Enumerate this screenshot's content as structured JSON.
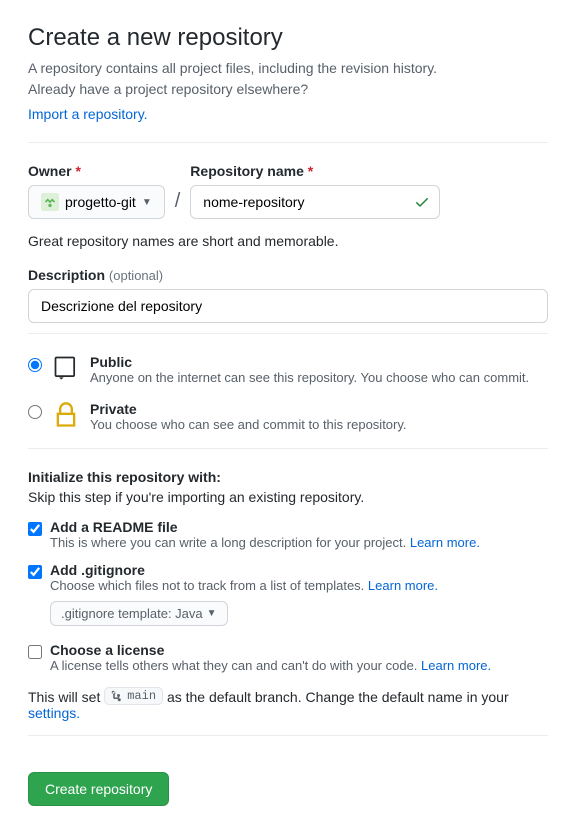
{
  "header": {
    "title": "Create a new repository",
    "intro1": "A repository contains all project files, including the revision history.",
    "intro2": "Already have a project repository elsewhere?",
    "import_link": "Import a repository."
  },
  "owner": {
    "label": "Owner",
    "value": "progetto-git"
  },
  "repo": {
    "label": "Repository name",
    "value": "nome-repository"
  },
  "hint": "Great repository names are short and memorable.",
  "description": {
    "label": "Description",
    "optional": "(optional)",
    "value": "Descrizione del repository"
  },
  "visibility": {
    "public": {
      "title": "Public",
      "desc": "Anyone on the internet can see this repository. You choose who can commit."
    },
    "private": {
      "title": "Private",
      "desc": "You choose who can see and commit to this repository."
    }
  },
  "init": {
    "title": "Initialize this repository with:",
    "sub": "Skip this step if you're importing an existing repository.",
    "readme": {
      "title": "Add a README file",
      "desc": "This is where you can write a long description for your project. ",
      "link": "Learn more."
    },
    "gitignore": {
      "title": "Add .gitignore",
      "desc": "Choose which files not to track from a list of templates. ",
      "link": "Learn more.",
      "template_label": ".gitignore template: Java"
    },
    "license": {
      "title": "Choose a license",
      "desc": "A license tells others what they can and can't do with your code. ",
      "link": "Learn more."
    }
  },
  "branch": {
    "prefix": "This will set ",
    "name": "main",
    "mid": " as the default branch. Change the default name in your ",
    "link": "settings."
  },
  "create_button": "Create repository"
}
